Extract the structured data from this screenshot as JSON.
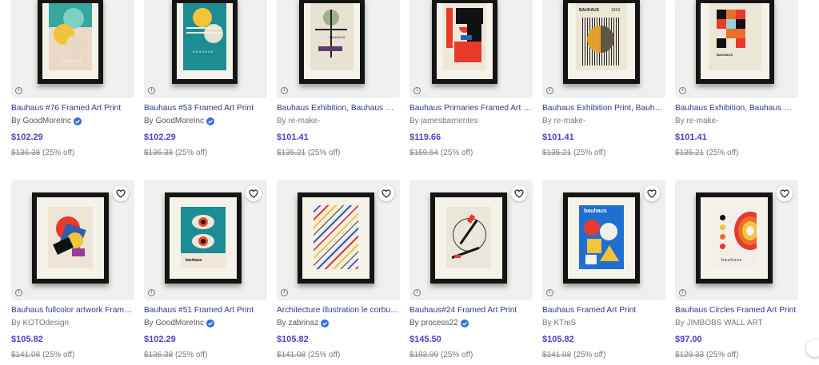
{
  "products": [
    {
      "title": "Bauhaus #76 Framed Art Print",
      "artist": "By GoodMoreInc",
      "verified": true,
      "price": "$102.29",
      "was": "$136.38",
      "discount": "(25% off)"
    },
    {
      "title": "Bauhaus #53 Framed Art Print",
      "artist": "By GoodMoreInc",
      "verified": true,
      "price": "$102.29",
      "was": "$136.38",
      "discount": "(25% off)"
    },
    {
      "title": "Bauhaus Exhibition, Bauhaus Wall...",
      "artist": "By re-make-",
      "verified": false,
      "price": "$101.41",
      "was": "$135.21",
      "discount": "(25% off)"
    },
    {
      "title": "Bauhaus Primaries Framed Art Print",
      "artist": "By jamesbarrientes",
      "verified": false,
      "price": "$119.66",
      "was": "$159.54",
      "discount": "(25% off)"
    },
    {
      "title": "Bauhaus Exhibition Print, Bauhaus...",
      "artist": "By re-make-",
      "verified": false,
      "price": "$101.41",
      "was": "$135.21",
      "discount": "(25% off)"
    },
    {
      "title": "Bauhaus Exhibition, Bauhaus Wall...",
      "artist": "By re-make-",
      "verified": false,
      "price": "$101.41",
      "was": "$135.21",
      "discount": "(25% off)"
    },
    {
      "title": "Bauhaus fullcolor artwork Framed...",
      "artist": "By KOTOdesign",
      "verified": false,
      "price": "$105.82",
      "was": "$141.08",
      "discount": "(25% off)"
    },
    {
      "title": "Bauhaus #51 Framed Art Print",
      "artist": "By GoodMoreInc",
      "verified": true,
      "price": "$102.29",
      "was": "$136.38",
      "discount": "(25% off)"
    },
    {
      "title": "Architecture illustration le corbusi...",
      "artist": "By zabrinaz",
      "verified": true,
      "price": "$105.82",
      "was": "$141.08",
      "discount": "(25% off)"
    },
    {
      "title": "Bauhaus#24 Framed Art Print",
      "artist": "By process22",
      "verified": true,
      "price": "$145.50",
      "was": "$193.99",
      "discount": "(25% off)"
    },
    {
      "title": "Bauhaus Framed Art Print",
      "artist": "By KTmS",
      "verified": false,
      "price": "$105.82",
      "was": "$141.08",
      "discount": "(25% off)"
    },
    {
      "title": "Bauhaus Circles Framed Art Print",
      "artist": "By JIMBOBS WALL ART",
      "verified": false,
      "price": "$97.00",
      "was": "$129.33",
      "discount": "(25% off)"
    }
  ],
  "art_text": {
    "p0": "BAUHAUS",
    "p1": "BAUHAUS",
    "p2": "BAUHAUS",
    "p4": "BAUHAUS",
    "p4b": "1919",
    "p5": "BAUHAUS",
    "p7": "bauhaus",
    "p10": "bauhaus",
    "p11": "bauhaus"
  },
  "icons": {
    "info": "info-icon",
    "heart": "heart-outline-icon",
    "verified": "verified-check-icon"
  },
  "colors": {
    "title": "#2d3a8c",
    "price": "#4b3fc9",
    "verified": "#2f6fde"
  }
}
